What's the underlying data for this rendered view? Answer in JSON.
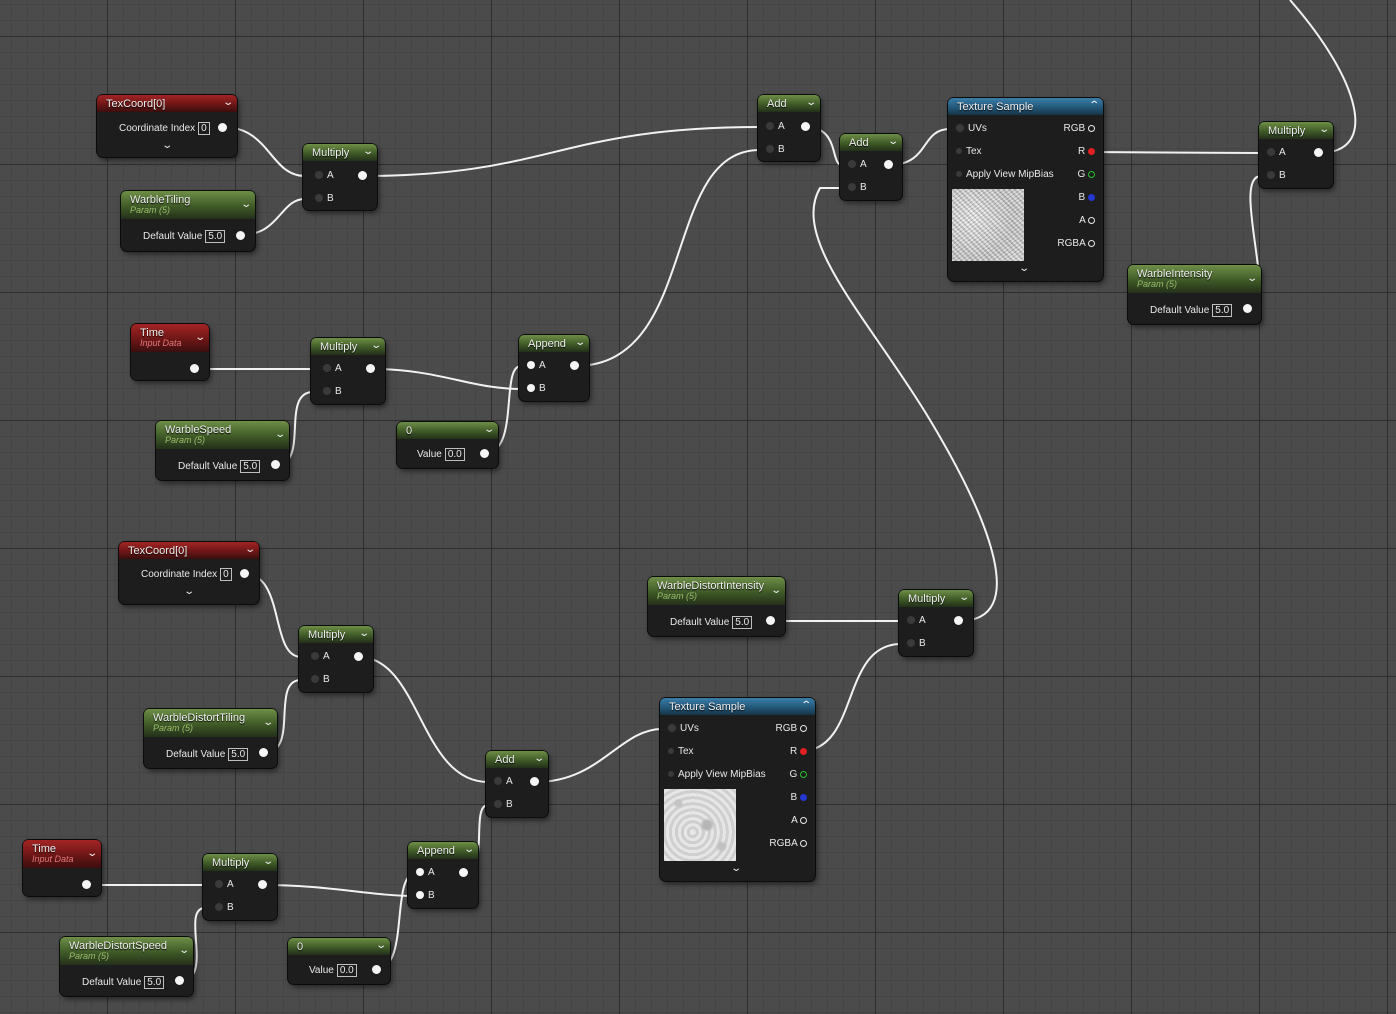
{
  "nodes": {
    "texcoord1": {
      "title": "TexCoord[0]",
      "coord_label": "Coordinate Index",
      "coord_value": "0"
    },
    "warble_tiling": {
      "title": "WarbleTiling",
      "subtitle": "Param (5)",
      "default_label": "Default Value",
      "default_value": "5.0"
    },
    "multiply1": {
      "title": "Multiply",
      "pin_a": "A",
      "pin_b": "B"
    },
    "time1": {
      "title": "Time",
      "subtitle": "Input Data"
    },
    "multiply2": {
      "title": "Multiply",
      "pin_a": "A",
      "pin_b": "B"
    },
    "warble_speed": {
      "title": "WarbleSpeed",
      "subtitle": "Param (5)",
      "default_label": "Default Value",
      "default_value": "5.0"
    },
    "const1": {
      "title": "0",
      "value_label": "Value",
      "value": "0.0"
    },
    "append1": {
      "title": "Append",
      "pin_a": "A",
      "pin_b": "B"
    },
    "add1": {
      "title": "Add",
      "pin_a": "A",
      "pin_b": "B"
    },
    "add2": {
      "title": "Add",
      "pin_a": "A",
      "pin_b": "B"
    },
    "texsample1": {
      "title": "Texture Sample",
      "in_uvs": "UVs",
      "in_tex": "Tex",
      "in_mip": "Apply View MipBias",
      "out_rgb": "RGB",
      "out_r": "R",
      "out_g": "G",
      "out_b": "B",
      "out_a": "A",
      "out_rgba": "RGBA"
    },
    "multiply3": {
      "title": "Multiply",
      "pin_a": "A",
      "pin_b": "B"
    },
    "warble_intensity": {
      "title": "WarbleIntensity",
      "subtitle": "Param (5)",
      "default_label": "Default Value",
      "default_value": "5.0"
    },
    "texcoord2": {
      "title": "TexCoord[0]",
      "coord_label": "Coordinate Index",
      "coord_value": "0"
    },
    "multiply4": {
      "title": "Multiply",
      "pin_a": "A",
      "pin_b": "B"
    },
    "warble_distort_tiling": {
      "title": "WarbleDistortTiling",
      "subtitle": "Param (5)",
      "default_label": "Default Value",
      "default_value": "5.0"
    },
    "warble_distort_intensity": {
      "title": "WarbleDistortIntensity",
      "subtitle": "Param (5)",
      "default_label": "Default Value",
      "default_value": "5.0"
    },
    "multiply5": {
      "title": "Multiply",
      "pin_a": "A",
      "pin_b": "B"
    },
    "texsample2": {
      "title": "Texture Sample",
      "in_uvs": "UVs",
      "in_tex": "Tex",
      "in_mip": "Apply View MipBias",
      "out_rgb": "RGB",
      "out_r": "R",
      "out_g": "G",
      "out_b": "B",
      "out_a": "A",
      "out_rgba": "RGBA"
    },
    "add3": {
      "title": "Add",
      "pin_a": "A",
      "pin_b": "B"
    },
    "time2": {
      "title": "Time",
      "subtitle": "Input Data"
    },
    "multiply6": {
      "title": "Multiply",
      "pin_a": "A",
      "pin_b": "B"
    },
    "append2": {
      "title": "Append",
      "pin_a": "A",
      "pin_b": "B"
    },
    "warble_distort_speed": {
      "title": "WarbleDistortSpeed",
      "subtitle": "Param (5)",
      "default_label": "Default Value",
      "default_value": "5.0"
    },
    "const2": {
      "title": "0",
      "value_label": "Value",
      "value": "0.0"
    }
  },
  "colors": {
    "param_header": "#4f6d33",
    "input_header": "#8a1c1c",
    "texture_header": "#2a6a93",
    "wire": "#f2f2f2"
  }
}
